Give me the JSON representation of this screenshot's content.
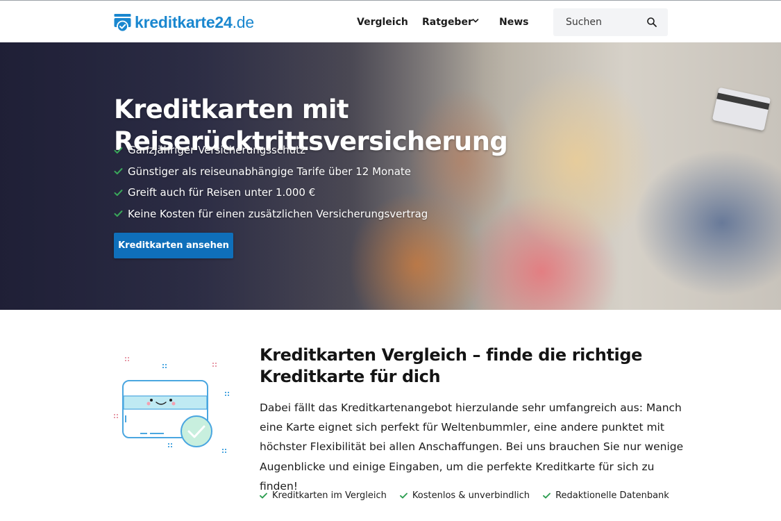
{
  "header": {
    "logo_text": "kreditkarte24",
    "logo_tld": ".de",
    "nav": {
      "vergleich": "Vergleich",
      "ratgeber": "Ratgeber",
      "news": "News"
    },
    "search_placeholder": "Suchen"
  },
  "hero": {
    "title": "Kreditkarten mit Reiserücktrittsversicherung",
    "bullets": [
      "Ganzjähriger Versicherungsschutz",
      "Günstiger als reiseunabhängige Tarife über 12 Monate",
      "Greift auch für Reisen unter 1.000 €",
      "Keine Kosten für einen zusätzlichen Versicherungsvertrag"
    ],
    "cta_label": "Kreditkarten ansehen"
  },
  "intro": {
    "title": "Kreditkarten Vergleich – finde die richtige Kreditkarte für dich",
    "text": "Dabei fällt das Kreditkartenangebot hierzulande sehr umfangreich aus: Manch eine Karte eignet sich perfekt für Weltenbummler, eine andere punktet mit höchster Flexibilität bei allen Anschaffungen. Bei uns brauchen Sie nur wenige Augenblicke und einige Eingaben, um die perfekte Kreditkarte für sich zu finden!",
    "features": [
      "Kreditkarten im Vergleich",
      "Kostenlos & unverbindlich",
      "Redaktionelle Datenbank"
    ]
  },
  "colors": {
    "brand_blue": "#1a87cf",
    "cta_blue": "#0f6fba",
    "check_green": "#2e9e52"
  },
  "icons": [
    "logo-card-check-icon",
    "chevron-down-icon",
    "search-icon",
    "check-icon",
    "credit-card-illustration"
  ]
}
